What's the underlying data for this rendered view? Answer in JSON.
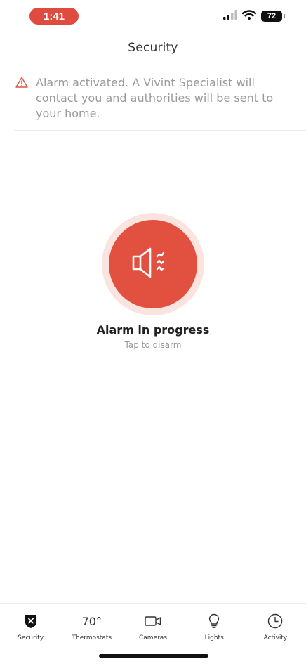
{
  "status_bar": {
    "time": "1:41",
    "battery": "72"
  },
  "header": {
    "title": "Security"
  },
  "alert": {
    "icon": "warning-triangle-icon",
    "lines": [
      "Alarm activated. A Vivint Specialist will",
      "contact you and authorities will be sent to",
      "your home."
    ],
    "color": "#e2503f"
  },
  "alarm": {
    "icon": "speaker-alarm-icon",
    "title": "Alarm in progress",
    "subtitle": "Tap to disarm",
    "color": "#e2503f",
    "halo_color": "#fbe4df"
  },
  "nav": {
    "items": [
      {
        "label": "Security",
        "icon": "shield-x-icon",
        "active": true
      },
      {
        "label": "Thermostats",
        "value": "70°"
      },
      {
        "label": "Cameras",
        "icon": "camera-icon"
      },
      {
        "label": "Lights",
        "icon": "lightbulb-icon"
      },
      {
        "label": "Activity",
        "icon": "clock-icon"
      }
    ]
  }
}
